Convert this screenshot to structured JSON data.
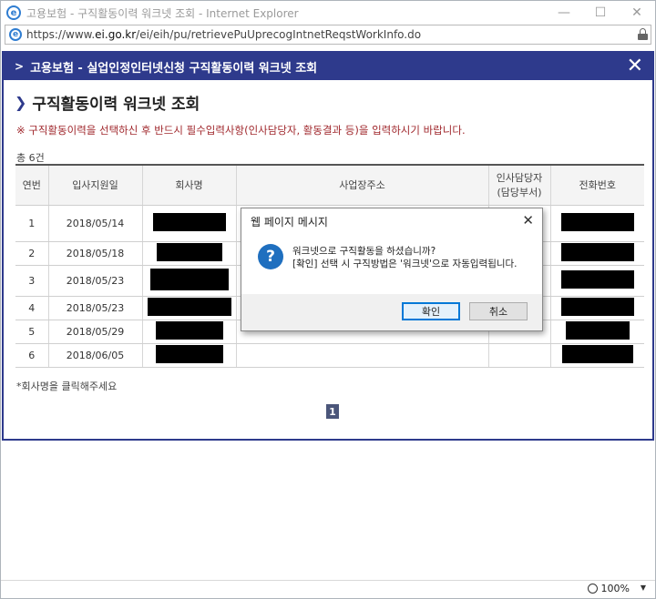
{
  "browser": {
    "window_title": "고용보험 - 구직활동이력 워크넷 조회 - Internet Explorer",
    "url_prefix": "https://www.",
    "url_domain": "ei.go.kr",
    "url_path": "/ei/eih/pu/retrievePuUprecogIntnetReqstWorkInfo.do",
    "minimize": "—",
    "maximize": "☐",
    "close": "✕",
    "zoom": "100%"
  },
  "popup": {
    "header_title": "고용보험 - 실업인정인터넷신청 구직활동이력 워크넷 조회",
    "close_symbol": "✕",
    "page_title": "구직활동이력 워크넷 조회",
    "notice": "※ 구직활동이력을 선택하신 후 반드시 필수입력사항(인사담당자, 활동결과 등)을 입력하시기 바랍니다.",
    "count_label": "총 6건",
    "helper_text": "*회사명을 클릭해주세요",
    "page_number": "1"
  },
  "table": {
    "headers": [
      "연번",
      "입사지원일",
      "회사명",
      "사업장주소",
      "인사담당자\n(담당부서)",
      "전화번호"
    ],
    "headers_line2": "(담당부서)",
    "headers_manager": "인사담당자",
    "rows": [
      {
        "no": "1",
        "date": "2018/05/14"
      },
      {
        "no": "2",
        "date": "2018/05/18"
      },
      {
        "no": "3",
        "date": "2018/05/23"
      },
      {
        "no": "4",
        "date": "2018/05/23"
      },
      {
        "no": "5",
        "date": "2018/05/29"
      },
      {
        "no": "6",
        "date": "2018/06/05"
      }
    ]
  },
  "dialog": {
    "title": "웹 페이지 메시지",
    "close_symbol": "✕",
    "icon": "question-icon",
    "message_line1": "워크넷으로 구직활동을 하셨습니까?",
    "message_line2": "[확인] 선택 시 구직방법은 '워크넷'으로 자동입력됩니다.",
    "ok_label": "확인",
    "cancel_label": "취소"
  },
  "colors": {
    "popup_header": "#2e3a8c",
    "notice_text": "#a0282d",
    "pager_bg": "#4b567a",
    "dialog_icon": "#1f6fbf"
  }
}
